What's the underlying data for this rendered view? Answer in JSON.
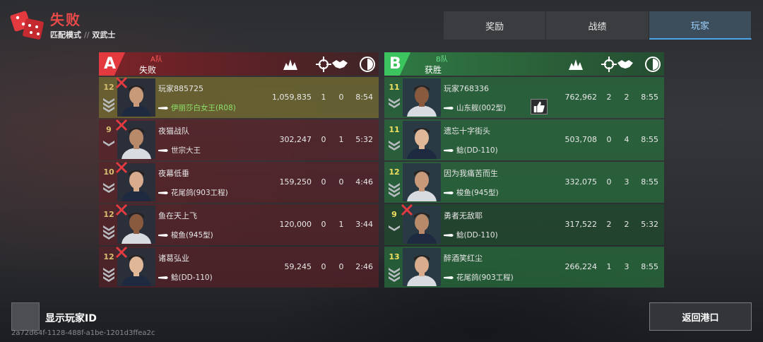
{
  "header": {
    "result": "失败",
    "mode": "匹配模式",
    "separator": "//",
    "submode": "双武士"
  },
  "tabs": [
    {
      "label": "奖励",
      "active": false
    },
    {
      "label": "战绩",
      "active": false
    },
    {
      "label": "玩家",
      "active": true
    }
  ],
  "team_a": {
    "letter": "A",
    "name": "A队",
    "state": "失败",
    "color": "#e33a40",
    "players": [
      {
        "level": "12",
        "name": "玩家885725",
        "ship": "伊丽莎白女王(R08)",
        "score": "1,059,835",
        "kills": "1",
        "assists": "0",
        "time": "8:54",
        "sunk": true,
        "me": true
      },
      {
        "level": "9",
        "name": "夜猫战队",
        "ship": "世宗大王",
        "score": "302,247",
        "kills": "0",
        "assists": "1",
        "time": "5:32",
        "sunk": true,
        "me": false
      },
      {
        "level": "10",
        "name": "夜幕低垂",
        "ship": "花尾鸽(903工程)",
        "score": "159,250",
        "kills": "0",
        "assists": "0",
        "time": "4:46",
        "sunk": true,
        "me": false
      },
      {
        "level": "12",
        "name": "鱼在天上飞",
        "ship": "梭鱼(945型)",
        "score": "120,000",
        "kills": "0",
        "assists": "1",
        "time": "3:44",
        "sunk": true,
        "me": false
      },
      {
        "level": "12",
        "name": "诸葛弘业",
        "ship": "鲶(DD-110)",
        "score": "59,245",
        "kills": "0",
        "assists": "0",
        "time": "2:46",
        "sunk": true,
        "me": false
      }
    ]
  },
  "team_b": {
    "letter": "B",
    "name": "B队",
    "state": "获胜",
    "color": "#3cc45e",
    "players": [
      {
        "level": "11",
        "name": "玩家768336",
        "ship": "山东舰(002型)",
        "score": "762,962",
        "kills": "2",
        "assists": "2",
        "time": "8:55",
        "sunk": false,
        "liked": true
      },
      {
        "level": "11",
        "name": "遗忘十字街头",
        "ship": "鲶(DD-110)",
        "score": "503,708",
        "kills": "0",
        "assists": "4",
        "time": "8:55",
        "sunk": false
      },
      {
        "level": "12",
        "name": "因为我痛苦而生",
        "ship": "梭鱼(945型)",
        "score": "332,075",
        "kills": "0",
        "assists": "3",
        "time": "8:55",
        "sunk": false
      },
      {
        "level": "9",
        "name": "勇者无敌耶",
        "ship": "鲶(DD-110)",
        "score": "317,522",
        "kills": "2",
        "assists": "2",
        "time": "5:32",
        "sunk": true
      },
      {
        "level": "13",
        "name": "醉酒笑红尘",
        "ship": "花尾鸽(903工程)",
        "score": "266,224",
        "kills": "1",
        "assists": "3",
        "time": "8:55",
        "sunk": false
      }
    ]
  },
  "column_icons": [
    "explosion-icon",
    "crosshair-icon",
    "handshake-icon",
    "clock-icon"
  ],
  "footer": {
    "show_id_label": "显示玩家ID",
    "show_id_checked": false,
    "match_id": "2a72d64f-1128-488f-a1be-1201d3ffea2c",
    "back_label": "返回港口"
  }
}
